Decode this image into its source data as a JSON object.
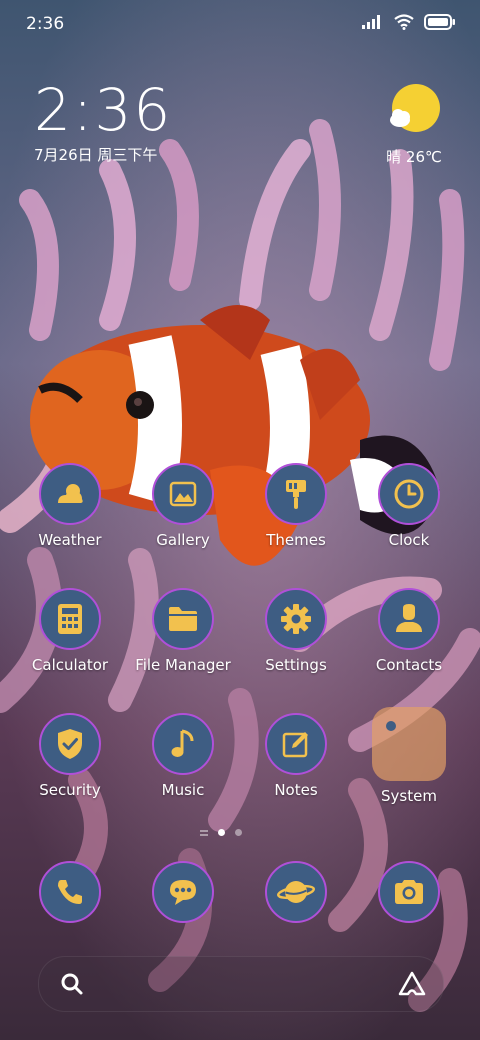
{
  "status_bar": {
    "time": "2:36",
    "icons": [
      "signal-icon",
      "wifi-icon",
      "battery-icon"
    ]
  },
  "clock_widget": {
    "time": "2:36",
    "date": "7月26日 周三下午"
  },
  "weather_widget": {
    "text": "晴 26℃",
    "icon": "sun-cloud-icon"
  },
  "apps": [
    {
      "label": "Weather",
      "icon": "weather-icon"
    },
    {
      "label": "Gallery",
      "icon": "gallery-icon"
    },
    {
      "label": "Themes",
      "icon": "paintbrush-icon"
    },
    {
      "label": "Clock",
      "icon": "clock-icon"
    },
    {
      "label": "Calculator",
      "icon": "calculator-icon"
    },
    {
      "label": "File Manager",
      "icon": "folder-icon"
    },
    {
      "label": "Settings",
      "icon": "gear-icon"
    },
    {
      "label": "Contacts",
      "icon": "contact-icon"
    },
    {
      "label": "Security",
      "icon": "shield-icon"
    },
    {
      "label": "Music",
      "icon": "music-note-icon"
    },
    {
      "label": "Notes",
      "icon": "note-edit-icon"
    },
    {
      "label": "System",
      "icon": "folder-group-icon"
    }
  ],
  "dock": [
    {
      "icon": "phone-icon"
    },
    {
      "icon": "message-icon"
    },
    {
      "icon": "browser-planet-icon"
    },
    {
      "icon": "camera-icon"
    }
  ],
  "page_indicator": {
    "pages": 2,
    "active": 1
  },
  "colors": {
    "icon_bg": "#3e5d83",
    "icon_ring": "#b050d8",
    "glyph": "#f2c14e",
    "folder": "#e4a066"
  }
}
